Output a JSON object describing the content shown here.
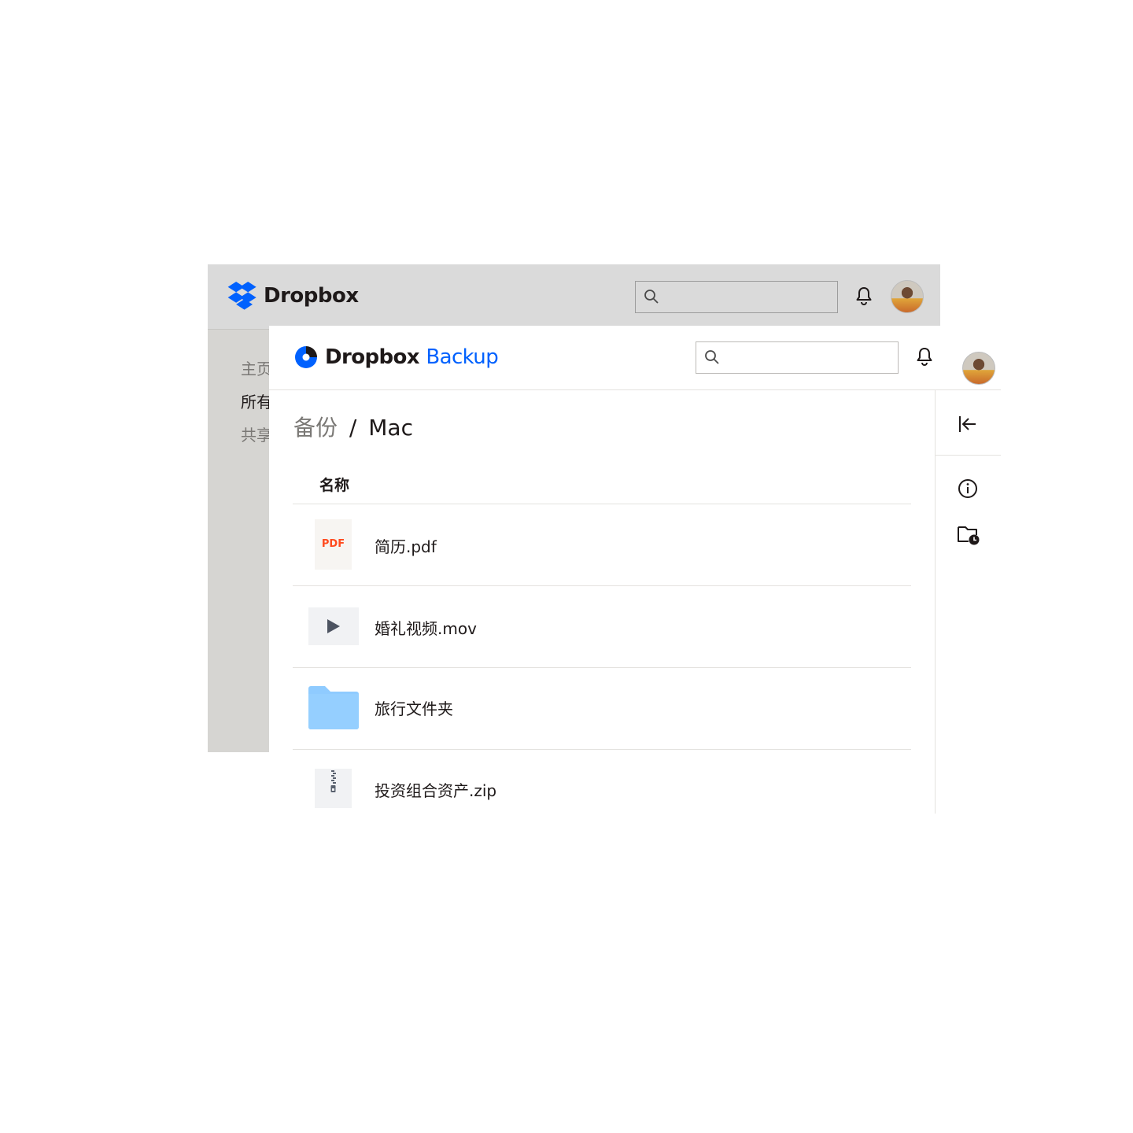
{
  "background_app": {
    "logo_text": "Dropbox",
    "search_placeholder": "",
    "nav": [
      {
        "label": "主页"
      },
      {
        "label": "所有"
      },
      {
        "label": "共享"
      }
    ]
  },
  "backup_app": {
    "logo_brand": "Dropbox",
    "logo_product": "Backup",
    "search_placeholder": "",
    "breadcrumb": {
      "parent": "备份",
      "separator": "/",
      "current": "Mac"
    },
    "column_header": "名称",
    "files": [
      {
        "name": "简历.pdf",
        "type": "pdf",
        "thumb_label": "PDF"
      },
      {
        "name": "婚礼视频.mov",
        "type": "video"
      },
      {
        "name": "旅行文件夹",
        "type": "folder"
      },
      {
        "name": "投资组合资产.zip",
        "type": "zip"
      }
    ],
    "rail_icons": [
      "collapse-panel-icon",
      "info-icon",
      "folder-history-icon"
    ]
  },
  "colors": {
    "brand_blue": "#0061fe",
    "pdf_red": "#ff4b1f",
    "folder_blue": "#8fcbff",
    "dim_background": "#d6d5d2"
  }
}
